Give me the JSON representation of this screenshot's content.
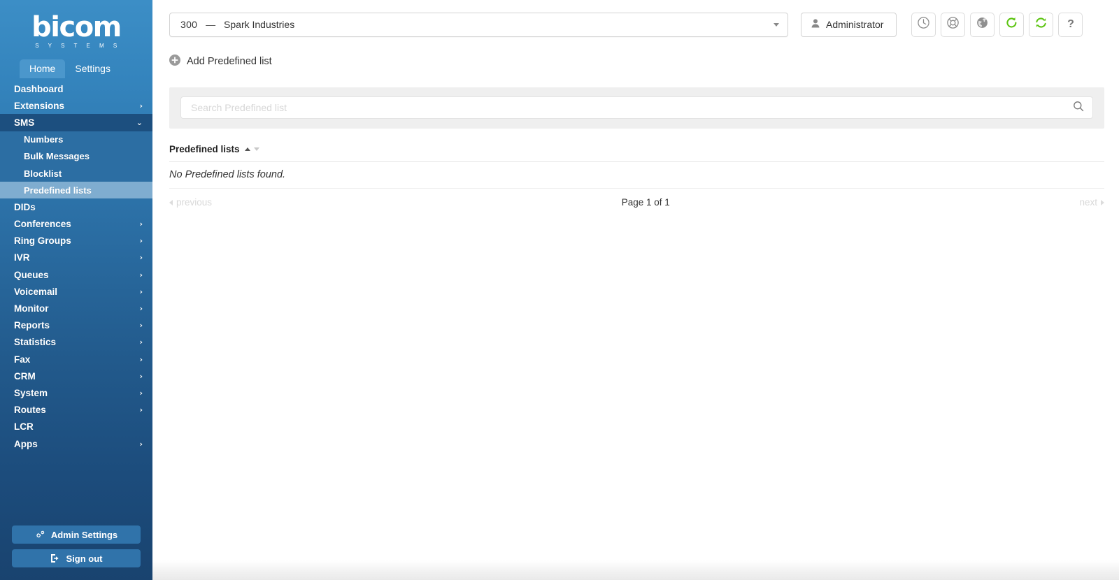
{
  "brand": {
    "name": "bicom",
    "tagline": "S Y S T E M S"
  },
  "tabs": [
    {
      "label": "Home",
      "active": true
    },
    {
      "label": "Settings",
      "active": false
    }
  ],
  "sidebar": {
    "items": [
      {
        "label": "Dashboard",
        "chevron": "",
        "state": "normal"
      },
      {
        "label": "Extensions",
        "chevron": "›",
        "state": "normal"
      },
      {
        "label": "SMS",
        "chevron": "⌄",
        "state": "open"
      },
      {
        "label": "Numbers",
        "chevron": "",
        "state": "sub"
      },
      {
        "label": "Bulk Messages",
        "chevron": "",
        "state": "sub"
      },
      {
        "label": "Blocklist",
        "chevron": "",
        "state": "sub"
      },
      {
        "label": "Predefined lists",
        "chevron": "",
        "state": "sub-selected"
      },
      {
        "label": "DIDs",
        "chevron": "",
        "state": "normal"
      },
      {
        "label": "Conferences",
        "chevron": "›",
        "state": "normal"
      },
      {
        "label": "Ring Groups",
        "chevron": "›",
        "state": "normal"
      },
      {
        "label": "IVR",
        "chevron": "›",
        "state": "normal"
      },
      {
        "label": "Queues",
        "chevron": "›",
        "state": "normal"
      },
      {
        "label": "Voicemail",
        "chevron": "›",
        "state": "normal"
      },
      {
        "label": "Monitor",
        "chevron": "›",
        "state": "normal"
      },
      {
        "label": "Reports",
        "chevron": "›",
        "state": "normal"
      },
      {
        "label": "Statistics",
        "chevron": "›",
        "state": "normal"
      },
      {
        "label": "Fax",
        "chevron": "›",
        "state": "normal"
      },
      {
        "label": "CRM",
        "chevron": "›",
        "state": "normal"
      },
      {
        "label": "System",
        "chevron": "›",
        "state": "normal"
      },
      {
        "label": "Routes",
        "chevron": "›",
        "state": "normal"
      },
      {
        "label": "LCR",
        "chevron": "",
        "state": "normal"
      },
      {
        "label": "Apps",
        "chevron": "›",
        "state": "normal"
      }
    ],
    "admin_settings_label": "Admin Settings",
    "sign_out_label": "Sign out"
  },
  "topbar": {
    "company": {
      "number": "300",
      "dash": "—",
      "name": "Spark Industries"
    },
    "user_label": "Administrator",
    "icons": [
      {
        "name": "clock-icon"
      },
      {
        "name": "lifebuoy-icon"
      },
      {
        "name": "globe-icon"
      },
      {
        "name": "reload-icon"
      },
      {
        "name": "sync-icon"
      },
      {
        "name": "help-icon",
        "glyph": "?"
      }
    ]
  },
  "actions": {
    "add_label": "Add Predefined list"
  },
  "search": {
    "placeholder": "Search Predefined list",
    "value": ""
  },
  "table": {
    "column_header": "Predefined lists",
    "empty_message": "No Predefined lists found."
  },
  "pagination": {
    "previous_label": "previous",
    "page_label": "Page 1 of 1",
    "next_label": "next"
  },
  "colors": {
    "sidebar_top": "#3c8ec6",
    "sidebar_bottom": "#19436f",
    "selected_item": "#7fadd0",
    "section_open": "#1c4f7f",
    "accent_green": "#5cc411"
  }
}
